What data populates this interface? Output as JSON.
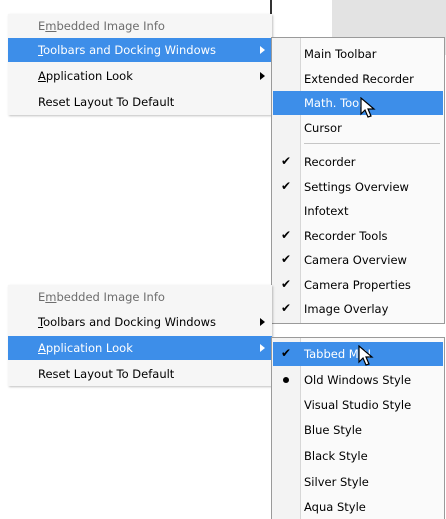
{
  "menu1": {
    "items": [
      {
        "pre": "E",
        "ul": "m",
        "post": "bedded Image Info"
      },
      {
        "pre": "",
        "ul": "T",
        "post": "oolbars and Docking Windows"
      },
      {
        "pre": "",
        "ul": "A",
        "post": "pplication Look"
      },
      {
        "pre": "",
        "ul": "",
        "post": "Reset Layout To Default"
      }
    ]
  },
  "submenu1": {
    "items": [
      "Main Toolbar",
      "Extended Recorder",
      "Math. Tool",
      "Cursor",
      "Recorder",
      "Settings Overview",
      "Infotext",
      "Recorder Tools",
      "Camera Overview",
      "Camera Properties",
      "Image Overlay"
    ]
  },
  "menu2": {
    "items": [
      {
        "pre": "E",
        "ul": "m",
        "post": "bedded Image Info"
      },
      {
        "pre": "",
        "ul": "T",
        "post": "oolbars and Docking Windows"
      },
      {
        "pre": "",
        "ul": "A",
        "post": "pplication Look"
      },
      {
        "pre": "",
        "ul": "",
        "post": "Reset Layout To Default"
      }
    ]
  },
  "submenu2": {
    "items": [
      "Tabbed MDI",
      "Old Windows Style",
      "Visual Studio Style",
      "Blue Style",
      "Black Style",
      "Silver Style",
      "Aqua Style"
    ]
  },
  "colors": {
    "highlight": "#3d8ee9",
    "disabled": "#6d6d6d"
  }
}
